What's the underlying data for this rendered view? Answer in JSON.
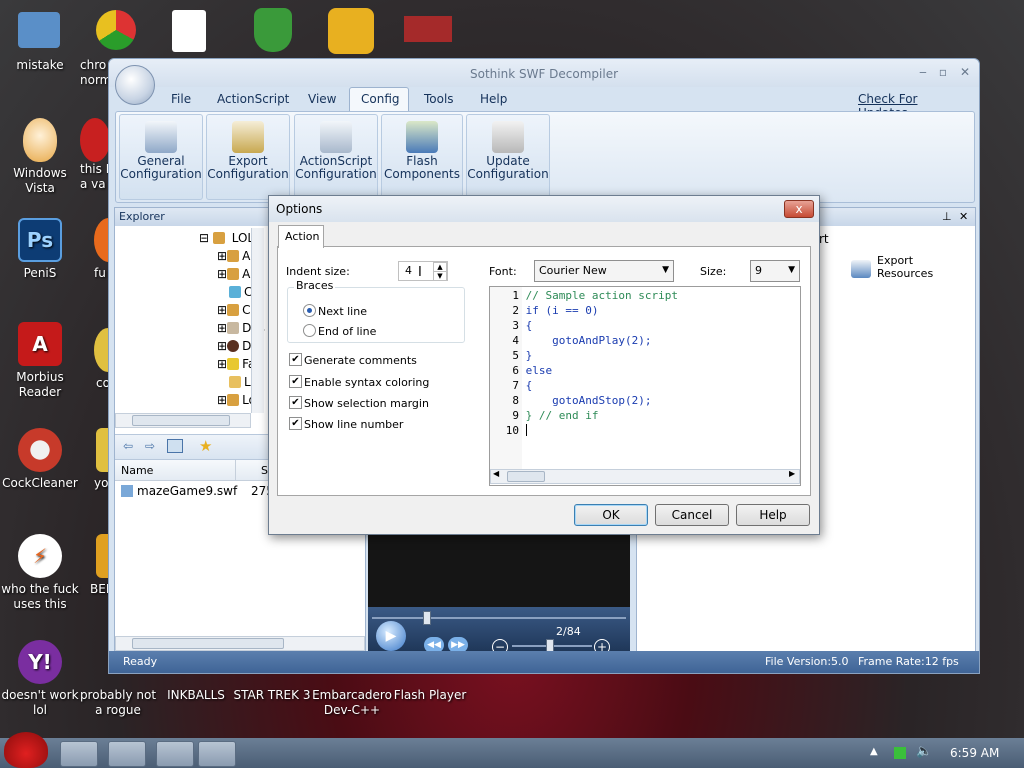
{
  "desktop_icons": [
    {
      "label": "mistake",
      "color": "#2c7fc1"
    },
    {
      "label": "chro\nnorm",
      "color": "#e9b021"
    },
    {
      "label": "Windows\nVista",
      "color": "#d9a55c"
    },
    {
      "label": "this I\na va",
      "color": "#cc2222"
    },
    {
      "label": "PeniS",
      "color": "#1e5fb0"
    },
    {
      "label": "fu",
      "color": "#e86a1c"
    },
    {
      "label": "Morbius\nReader",
      "color": "#c51a1a"
    },
    {
      "label": "co",
      "color": "#e0c040"
    },
    {
      "label": "CockCleaner",
      "color": "#c73a2a"
    },
    {
      "label": "yo",
      "color": "#e0c040"
    },
    {
      "label": "who the fuck\nuses this",
      "color": "#e8641c"
    },
    {
      "label": "BEE",
      "color": "#e0a020"
    },
    {
      "label": "doesn't work\nlol",
      "color": "#7a2ea0"
    },
    {
      "label": "probably not\na rogue",
      "color": "#3a6fb0"
    },
    {
      "label": "INKBALLS",
      "color": "#2a8a3a"
    },
    {
      "label": "STAR TREK 3",
      "color": "#b0882a"
    },
    {
      "label": "Embarcadero\nDev-C++",
      "color": "#b02a2a"
    },
    {
      "label": "Flash Player",
      "color": "#b01a1a"
    }
  ],
  "window": {
    "title": "Sothink SWF Decompiler",
    "menu": [
      "File",
      "ActionScript",
      "View",
      "Config",
      "Tools",
      "Help"
    ],
    "active_menu": "Config",
    "check_updates": "Check For Updates...",
    "ribbon": [
      {
        "label": "General\nConfiguration"
      },
      {
        "label": "Export\nConfiguration"
      },
      {
        "label": "ActionScript\nConfiguration"
      },
      {
        "label": "Flash\nComponents"
      },
      {
        "label": "Update\nConfiguration"
      }
    ]
  },
  "explorer": {
    "title": "Explorer",
    "root": "LOL",
    "items": [
      "Ap",
      "Ap",
      "Co",
      "Co",
      "Des",
      "Do",
      "Fav",
      "Lin",
      "Loc"
    ],
    "name_header": "Name",
    "size_header": "Si",
    "file_name": "mazeGame9.swf",
    "file_size": "275"
  },
  "right_panel": {
    "tab_fragment": "rt",
    "export_label": "Export\nResources"
  },
  "player": {
    "frame_counter": "2/84"
  },
  "status": {
    "ready": "Ready",
    "file_version": "File Version:5.0",
    "frame_rate": "Frame Rate:12 fps"
  },
  "dialog": {
    "title": "Options",
    "close": "x",
    "tab": "Action",
    "indent_label": "Indent size:",
    "indent_value": "4",
    "braces_group": "Braces",
    "brace_next_line": "Next line",
    "brace_end_of_line": "End of line",
    "brace_selected": "next",
    "checkboxes": [
      {
        "label": "Generate comments",
        "checked": true
      },
      {
        "label": "Enable syntax coloring",
        "checked": true
      },
      {
        "label": "Show selection margin",
        "checked": true
      },
      {
        "label": "Show line number",
        "checked": true
      }
    ],
    "font_label": "Font:",
    "font_value": "Courier New",
    "size_label": "Size:",
    "size_value": "9",
    "code_lines": [
      {
        "n": "1",
        "text": "// Sample action script",
        "color": "#2e8b57"
      },
      {
        "n": "2",
        "text": "if (i == 0)",
        "color": "#1a3cb0"
      },
      {
        "n": "3",
        "text": "{",
        "color": "#1a3cb0"
      },
      {
        "n": "4",
        "text": "    gotoAndPlay(2);",
        "color": "#1a3cb0"
      },
      {
        "n": "5",
        "text": "}",
        "color": "#1a3cb0"
      },
      {
        "n": "6",
        "text": "else",
        "color": "#1a3cb0"
      },
      {
        "n": "7",
        "text": "{",
        "color": "#1a3cb0"
      },
      {
        "n": "8",
        "text": "    gotoAndStop(2);",
        "color": "#1a3cb0"
      },
      {
        "n": "9",
        "text": "} // end if",
        "color": "#2e8b57"
      },
      {
        "n": "10",
        "text": "",
        "color": "#1a3cb0"
      }
    ],
    "ok": "OK",
    "cancel": "Cancel",
    "help": "Help"
  },
  "taskbar": {
    "clock": "6:59 AM"
  }
}
